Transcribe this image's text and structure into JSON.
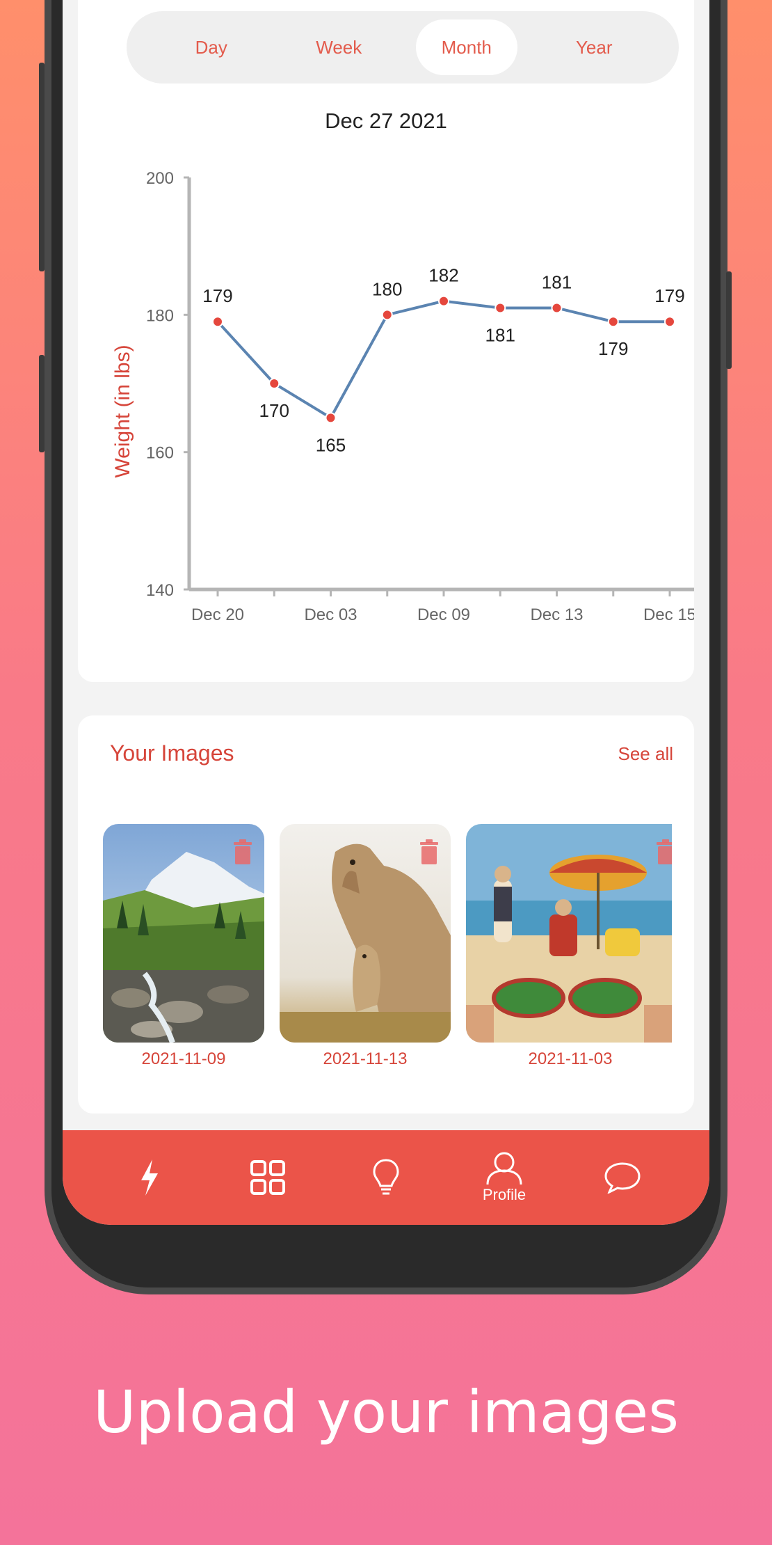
{
  "period_tabs": [
    {
      "label": "Day",
      "active": false
    },
    {
      "label": "Week",
      "active": false
    },
    {
      "label": "Month",
      "active": true
    },
    {
      "label": "Year",
      "active": false
    }
  ],
  "chart_date": "Dec 27 2021",
  "chart_data": {
    "type": "line",
    "ylabel": "Weight (in lbs)",
    "ylim": [
      140,
      200
    ],
    "yticks": [
      140,
      160,
      180,
      200
    ],
    "xtick_labels": [
      "Dec 20",
      "Dec 03",
      "Dec 09",
      "Dec 13",
      "Dec 15"
    ],
    "values": [
      179,
      170,
      165,
      180,
      182,
      181,
      181,
      179,
      179
    ],
    "line_color": "#5b84b1",
    "point_color": "#e5473d"
  },
  "images_section": {
    "title": "Your Images",
    "see_all": "See all",
    "items": [
      {
        "date": "2021-11-09",
        "scene": "mountain-stream"
      },
      {
        "date": "2021-11-13",
        "scene": "cougar"
      },
      {
        "date": "2021-11-03",
        "scene": "beach"
      }
    ]
  },
  "nav": {
    "items": [
      {
        "icon": "bolt-icon",
        "label": ""
      },
      {
        "icon": "grid-icon",
        "label": ""
      },
      {
        "icon": "lightbulb-icon",
        "label": ""
      },
      {
        "icon": "profile-icon",
        "label": "Profile"
      },
      {
        "icon": "chat-icon",
        "label": ""
      }
    ]
  },
  "caption": "Upload your images",
  "colors": {
    "accent": "#eb5449",
    "text_accent": "#d6453a"
  }
}
